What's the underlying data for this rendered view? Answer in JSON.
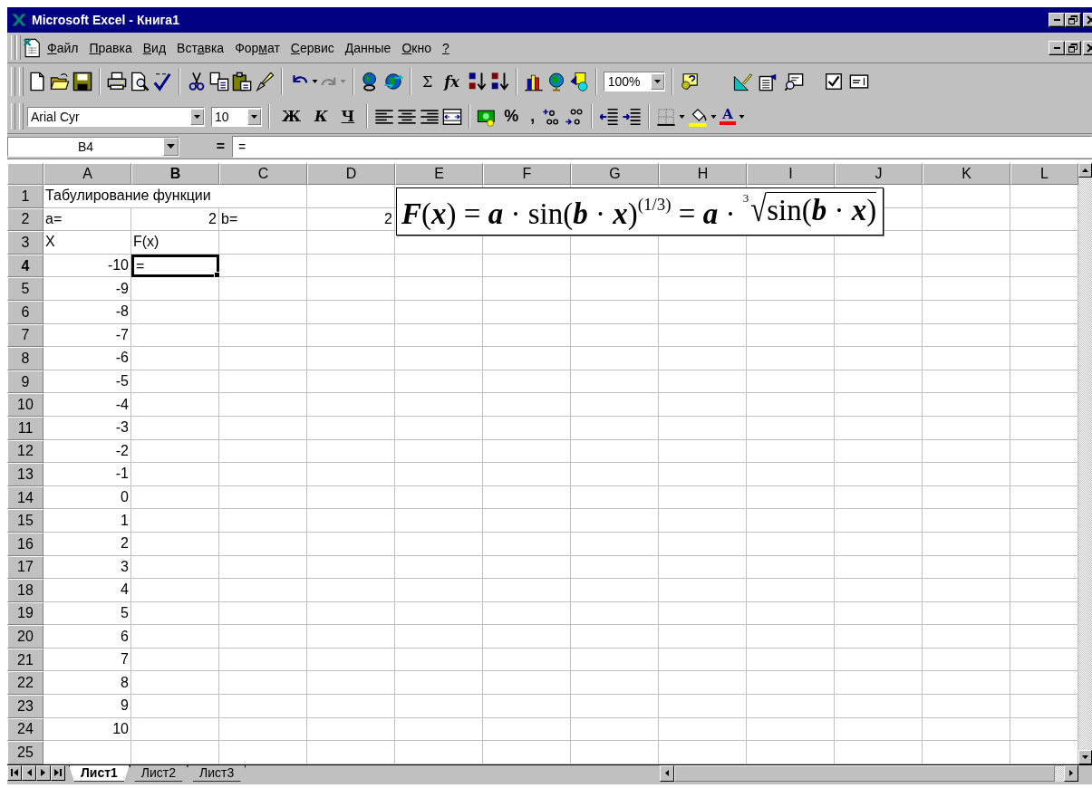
{
  "window": {
    "title": "Microsoft Excel - Книга1"
  },
  "menu": [
    {
      "key": "Ф",
      "post": "айл"
    },
    {
      "key": "П",
      "post": "равка"
    },
    {
      "key": "В",
      "post": "ид"
    },
    {
      "pre": "Вст",
      "key": "а",
      "post": "вка"
    },
    {
      "pre": "Фор",
      "key": "м",
      "post": "ат"
    },
    {
      "key": "С",
      "post": "ервис"
    },
    {
      "key": "Д",
      "post": "анные"
    },
    {
      "key": "О",
      "post": "кно"
    },
    {
      "key": "?"
    }
  ],
  "toolbar": {
    "autosum": "Σ",
    "function": "fx",
    "zoom": "100%"
  },
  "format_toolbar": {
    "font": "Arial Cyr",
    "size": "10",
    "bold": "Ж",
    "italic": "К",
    "underline": "Ч",
    "percent": "%",
    "comma": ",",
    "font_color": "A"
  },
  "formula_bar": {
    "name_box": "B4",
    "equals": "=",
    "content": "="
  },
  "columns": [
    {
      "label": "A",
      "selected": false
    },
    {
      "label": "B",
      "selected": true
    },
    {
      "label": "C",
      "selected": false
    },
    {
      "label": "D",
      "selected": false
    },
    {
      "label": "E",
      "selected": false
    },
    {
      "label": "F",
      "selected": false
    },
    {
      "label": "G",
      "selected": false
    },
    {
      "label": "H",
      "selected": false
    },
    {
      "label": "I",
      "selected": false
    },
    {
      "label": "J",
      "selected": false
    },
    {
      "label": "K",
      "selected": false
    },
    {
      "label": "L",
      "selected": false
    }
  ],
  "rows": [
    {
      "label": "1",
      "selected": false,
      "cells": {
        "a": {
          "text": "Табулирование функции",
          "kind": "text",
          "selected": false
        }
      }
    },
    {
      "label": "2",
      "selected": false,
      "cells": {
        "a": {
          "text": "a=",
          "kind": "text",
          "selected": false
        },
        "b": {
          "text": "2",
          "kind": "number",
          "selected": false
        },
        "c": {
          "text": "b=",
          "kind": "text",
          "selected": false
        },
        "d": {
          "text": "2",
          "kind": "number",
          "selected": false
        }
      }
    },
    {
      "label": "3",
      "selected": false,
      "cells": {
        "a": {
          "text": "X",
          "kind": "text",
          "selected": false
        },
        "b": {
          "text": "F(x)",
          "kind": "text",
          "selected": false
        }
      }
    },
    {
      "label": "4",
      "selected": true,
      "cells": {
        "a": {
          "text": "-10",
          "kind": "number",
          "selected": false
        },
        "b": {
          "text": "=",
          "kind": "text",
          "selected": true
        }
      }
    },
    {
      "label": "5",
      "selected": false,
      "cells": {
        "a": {
          "text": "-9",
          "kind": "number",
          "selected": false
        }
      }
    },
    {
      "label": "6",
      "selected": false,
      "cells": {
        "a": {
          "text": "-8",
          "kind": "number",
          "selected": false
        }
      }
    },
    {
      "label": "7",
      "selected": false,
      "cells": {
        "a": {
          "text": "-7",
          "kind": "number",
          "selected": false
        }
      }
    },
    {
      "label": "8",
      "selected": false,
      "cells": {
        "a": {
          "text": "-6",
          "kind": "number",
          "selected": false
        }
      }
    },
    {
      "label": "9",
      "selected": false,
      "cells": {
        "a": {
          "text": "-5",
          "kind": "number",
          "selected": false
        }
      }
    },
    {
      "label": "10",
      "selected": false,
      "cells": {
        "a": {
          "text": "-4",
          "kind": "number",
          "selected": false
        }
      }
    },
    {
      "label": "11",
      "selected": false,
      "cells": {
        "a": {
          "text": "-3",
          "kind": "number",
          "selected": false
        }
      }
    },
    {
      "label": "12",
      "selected": false,
      "cells": {
        "a": {
          "text": "-2",
          "kind": "number",
          "selected": false
        }
      }
    },
    {
      "label": "13",
      "selected": false,
      "cells": {
        "a": {
          "text": "-1",
          "kind": "number",
          "selected": false
        }
      }
    },
    {
      "label": "14",
      "selected": false,
      "cells": {
        "a": {
          "text": "0",
          "kind": "number",
          "selected": false
        }
      }
    },
    {
      "label": "15",
      "selected": false,
      "cells": {
        "a": {
          "text": "1",
          "kind": "number",
          "selected": false
        }
      }
    },
    {
      "label": "16",
      "selected": false,
      "cells": {
        "a": {
          "text": "2",
          "kind": "number",
          "selected": false
        }
      }
    },
    {
      "label": "17",
      "selected": false,
      "cells": {
        "a": {
          "text": "3",
          "kind": "number",
          "selected": false
        }
      }
    },
    {
      "label": "18",
      "selected": false,
      "cells": {
        "a": {
          "text": "4",
          "kind": "number",
          "selected": false
        }
      }
    },
    {
      "label": "19",
      "selected": false,
      "cells": {
        "a": {
          "text": "5",
          "kind": "number",
          "selected": false
        }
      }
    },
    {
      "label": "20",
      "selected": false,
      "cells": {
        "a": {
          "text": "6",
          "kind": "number",
          "selected": false
        }
      }
    },
    {
      "label": "21",
      "selected": false,
      "cells": {
        "a": {
          "text": "7",
          "kind": "number",
          "selected": false
        }
      }
    },
    {
      "label": "22",
      "selected": false,
      "cells": {
        "a": {
          "text": "8",
          "kind": "number",
          "selected": false
        }
      }
    },
    {
      "label": "23",
      "selected": false,
      "cells": {
        "a": {
          "text": "9",
          "kind": "number",
          "selected": false
        }
      }
    },
    {
      "label": "24",
      "selected": false,
      "cells": {
        "a": {
          "text": "10",
          "kind": "number",
          "selected": false
        }
      }
    },
    {
      "label": "25",
      "selected": false,
      "cells": {}
    }
  ],
  "equation": {
    "parts": [
      {
        "kind": "bold_italic",
        "text": "F"
      },
      {
        "kind": "plain",
        "text": "("
      },
      {
        "kind": "bold_italic",
        "text": "x"
      },
      {
        "kind": "plain",
        "text": ")"
      },
      {
        "kind": "plain",
        "text": " = "
      },
      {
        "kind": "bold_italic",
        "text": "a"
      },
      {
        "kind": "plain",
        "text": " · sin("
      },
      {
        "kind": "bold_italic",
        "text": "b"
      },
      {
        "kind": "plain",
        "text": " · "
      },
      {
        "kind": "bold_italic",
        "text": "x"
      },
      {
        "kind": "plain",
        "text": ")"
      },
      {
        "kind": "superscript",
        "text": "(1/3)"
      },
      {
        "kind": "plain",
        "text": " = "
      },
      {
        "kind": "bold_italic",
        "text": "a"
      },
      {
        "kind": "plain",
        "text": " · "
      },
      {
        "kind": "root",
        "index": "3",
        "sign": "√",
        "parts": [
          {
            "kind": "plain",
            "text": "sin("
          },
          {
            "kind": "bold_italic",
            "text": "b"
          },
          {
            "kind": "plain",
            "text": " · "
          },
          {
            "kind": "bold_italic",
            "text": "x"
          },
          {
            "kind": "plain",
            "text": ")"
          }
        ]
      }
    ]
  },
  "sheet_tabs": [
    {
      "label": "Лист1",
      "selected": true
    },
    {
      "label": "Лист2",
      "selected": false
    },
    {
      "label": "Лист3",
      "selected": false
    }
  ]
}
